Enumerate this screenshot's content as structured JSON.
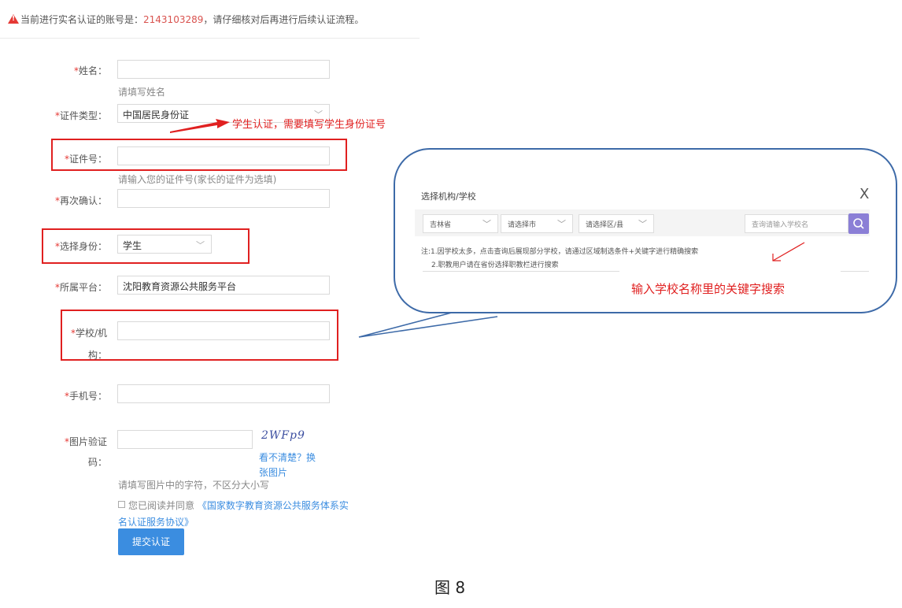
{
  "notice": {
    "prefix": "当前进行实名认证的账号是：",
    "account": "2143103289",
    "suffix": "，请仔细核对后再进行后续认证流程。"
  },
  "form": {
    "name": {
      "label": "姓名：",
      "value": "",
      "hint": "请填写姓名"
    },
    "id_type": {
      "label": "证件类型：",
      "value": "中国居民身份证"
    },
    "id_number": {
      "label": "证件号：",
      "value": "",
      "hint": "请输入您的证件号(家长的证件为选填)"
    },
    "confirm": {
      "label": "再次确认：",
      "value": ""
    },
    "role": {
      "label": "选择身份：",
      "value": "学生"
    },
    "platform": {
      "label": "所属平台：",
      "value": "沈阳教育资源公共服务平台"
    },
    "school": {
      "label_line1": "学校/机",
      "label_line2": "构：",
      "value": ""
    },
    "phone": {
      "label": "手机号：",
      "value": ""
    },
    "captcha": {
      "label_line1": "图片验证",
      "label_line2": "码：",
      "value": "",
      "image_text": "2WFp9",
      "refresh_line1": "看不清楚？换",
      "refresh_line2": "张图片",
      "hint": "请填写图片中的字符，不区分大小写"
    },
    "agreement": {
      "prefix": "您已阅读并同意",
      "link_line1": "《国家数字教育资源公共服务体系实",
      "link_line2": "名认证服务协议》"
    },
    "submit_label": "提交认证",
    "required_mark": "*"
  },
  "annotations": {
    "student_note": "学生认证，需要填写学生身份证号",
    "search_note": "输入学校名称里的关键字搜索"
  },
  "modal": {
    "title": "选择机构/学校",
    "close": "X",
    "province": "吉林省",
    "city": "请选择市",
    "district": "请选择区/县",
    "search_placeholder": "查询请输入学校名",
    "note_line1": "注:1.因学校太多，点击查询后展现部分学校，请通过区域制选条件+关键字进行精确搜索",
    "note_line2": "2.职教用户请在省份选择职教栏进行搜索"
  },
  "figure_caption": "图 8",
  "colors": {
    "accent": "#3b8de0",
    "required": "#e53935",
    "annotation": "#e02020",
    "bubble_border": "#3d6aa8",
    "search_btn": "#8b7fd6"
  }
}
